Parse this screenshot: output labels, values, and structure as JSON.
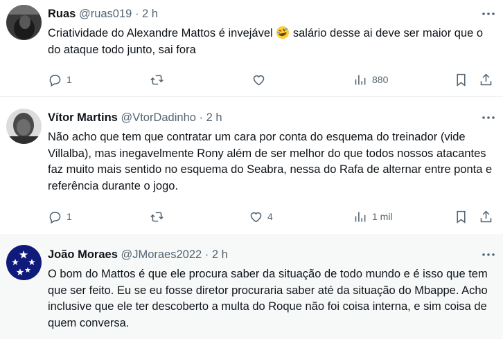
{
  "tweets": [
    {
      "name": "Ruas",
      "handle": "@ruas019",
      "time": "2 h",
      "text_a": "Criatividade do Alexandre Mattos é invejável ",
      "emoji": "rolling-on-floor-laughing-emoji",
      "text_b": " salário desse ai deve ser maior que o do ataque todo junto, sai fora",
      "replies": "1",
      "retweets": "",
      "likes": "",
      "views": "880"
    },
    {
      "name": "Vítor Martins",
      "handle": "@VtorDadinho",
      "time": "2 h",
      "text": "Não acho que tem que contratar um cara por conta do esquema do treinador (vide Villalba), mas inegavelmente Rony além de ser melhor do que todos nossos atacantes faz muito mais sentido no esquema do Seabra, nessa do Rafa de alternar entre ponta e referência durante o jogo.",
      "replies": "1",
      "retweets": "",
      "likes": "4",
      "views": "1 mil"
    },
    {
      "name": "João Moraes",
      "handle": "@JMoraes2022",
      "time": "2 h",
      "text": "O bom do Mattos é que ele procura saber da situação de todo mundo e é isso que tem que ser feito. Eu se eu fosse diretor procuraria saber até da situação do Mbappe. Acho inclusive que ele ter descoberto a multa do Roque não foi coisa interna, e sim coisa de quem conversa."
    }
  ],
  "separator": "·",
  "icons": [
    "more-icon",
    "reply-icon",
    "retweet-icon",
    "like-icon",
    "views-icon",
    "bookmark-icon",
    "share-icon"
  ],
  "colors": {
    "text": "#0f1419",
    "secondary": "#536471",
    "divider": "#eff3f4"
  }
}
